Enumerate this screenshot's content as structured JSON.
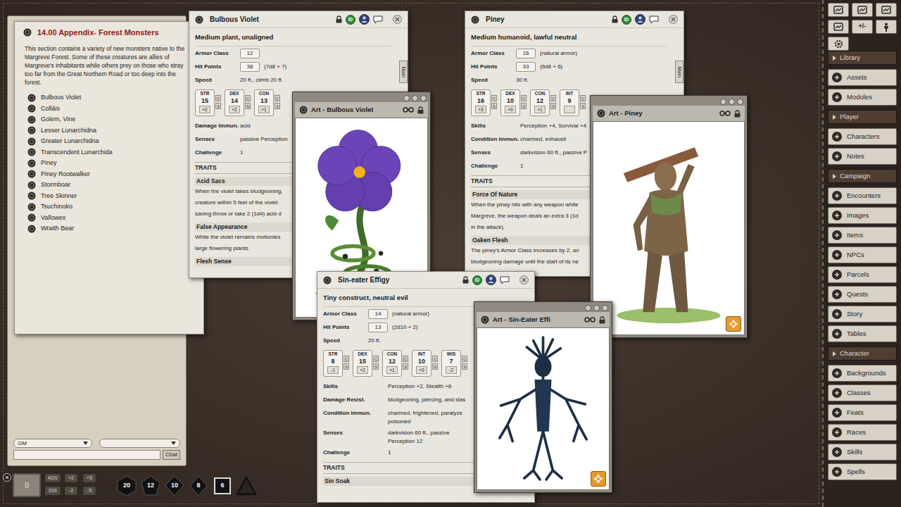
{
  "appendix": {
    "title": "14.00 Appendix- Forest Monsters",
    "intro_lines": [
      "This section contains a variety of new monsters native to the",
      "Margreve Forest. Some of these creatures are allies of",
      "Margreve's inhabitants while others prey on those who stray",
      "too far from the Great Northern Road or too deep into the",
      "forest."
    ],
    "items": [
      "Bulbous Violet",
      "Colláis",
      "Golem, Vine",
      "Lesser Lunarchidna",
      "Greater Lunarchidna",
      "Transcendent Lunarchida",
      "Piney",
      "Piney Rootwalker",
      "Stormboar",
      "Tree Skinner",
      "Tsuchinoko",
      "Vallowex",
      "Wraith Bear"
    ]
  },
  "chat": {
    "identity": "GM",
    "button": "Chat"
  },
  "ability_buttons": [
    "C",
    "S"
  ],
  "statblocks": [
    {
      "name": "Bulbous Violet",
      "id_badge": "ID",
      "tab": "Main",
      "type": "Medium plant, unaligned",
      "armor": {
        "label": "Armor Class",
        "value": "12"
      },
      "hit_points": {
        "label": "Hit Points",
        "value": "38",
        "note": "(7d8 + 7)"
      },
      "speed": {
        "label": "Speed",
        "value": "20 ft., climb 20 ft."
      },
      "abilities": [
        {
          "label": "STR",
          "score": "15",
          "mod": "+2"
        },
        {
          "label": "DEX",
          "score": "14",
          "mod": "+2"
        },
        {
          "label": "CON",
          "score": "13",
          "mod": "+1"
        }
      ],
      "properties": [
        {
          "label": "Damage Immun.",
          "lines": [
            "acid"
          ]
        },
        {
          "label": "Senses",
          "lines": [
            "passive Perception"
          ]
        },
        {
          "label": "Challenge",
          "lines": [
            "1"
          ]
        }
      ],
      "traits_heading": "TRAITS",
      "traits": [
        {
          "name": "Acid Sacs",
          "lines": [
            "When the violet takes bludgeoning,",
            "creature within 5 feet of the violet",
            "saving throw or take 2 (1d4) acid d"
          ]
        },
        {
          "name": "False Appearance",
          "lines": [
            "While the violet remains motionles",
            "large flowering plants."
          ]
        },
        {
          "name": "Flesh Sense",
          "lines": []
        }
      ]
    },
    {
      "name": "Piney",
      "id_badge": "ID",
      "tab": "Main",
      "type": "Medium humanoid, lawful neutral",
      "armor": {
        "label": "Armor Class",
        "value": "16",
        "note": "(natural armor)"
      },
      "hit_points": {
        "label": "Hit Points",
        "value": "33",
        "note": "(6d8 + 6)"
      },
      "speed": {
        "label": "Speed",
        "value": "30 ft."
      },
      "abilities": [
        {
          "label": "STR",
          "score": "16",
          "mod": "+3"
        },
        {
          "label": "DEX",
          "score": "10",
          "mod": "+0"
        },
        {
          "label": "CON",
          "score": "12",
          "mod": "+1"
        },
        {
          "label": "INT",
          "score": "9"
        }
      ],
      "properties": [
        {
          "label": "Skills",
          "lines": [
            "Perception +4, Survival +4"
          ]
        },
        {
          "label": "Condition Immun.",
          "lines": [
            "charmed, exhausti"
          ]
        },
        {
          "label": "Senses",
          "lines": [
            "darkvision 60 ft., passive P"
          ]
        },
        {
          "label": "Challenge",
          "lines": [
            "1"
          ]
        }
      ],
      "traits_heading": "TRAITS",
      "traits": [
        {
          "name": "Force Of Nature",
          "lines": [
            "When the piney hits with any weapon while",
            "Margreve, the weapon deals an extra 3 (1d",
            "in the attack)."
          ]
        },
        {
          "name": "Oaken Flesh",
          "lines": [
            "The piney's Armor Class increases by 2, an",
            "bludgeoning damage until the start of its ne"
          ]
        }
      ]
    },
    {
      "name": "Sin-eater Effigy",
      "id_badge": "ID",
      "type": "Tiny construct, neutral evil",
      "armor": {
        "label": "Armor Class",
        "value": "14",
        "note": "(natural armor)"
      },
      "hit_points": {
        "label": "Hit Points",
        "value": "13",
        "note": "(2d10 + 2)"
      },
      "speed": {
        "label": "Speed",
        "value": "20 ft."
      },
      "abilities": [
        {
          "label": "STR",
          "score": "8",
          "mod": "-1"
        },
        {
          "label": "DEX",
          "score": "15",
          "mod": "+2"
        },
        {
          "label": "CON",
          "score": "12",
          "mod": "+1"
        },
        {
          "label": "INT",
          "score": "10",
          "mod": "+0"
        },
        {
          "label": "WIS",
          "score": "7",
          "mod": "-2"
        }
      ],
      "properties": [
        {
          "label": "Skills",
          "lines": [
            "Perception +2, Stealth +6"
          ]
        },
        {
          "label": "Damage Resist.",
          "lines": [
            "bludgeoning, piercing, and slas"
          ]
        },
        {
          "label": "Condition Immun.",
          "lines": [
            "charmed, frightened, paralyze",
            "poisoned"
          ]
        },
        {
          "label": "Senses",
          "lines": [
            "darkvision 60 ft., passive Perception 12"
          ]
        },
        {
          "label": "Challenge",
          "lines": [
            "1"
          ]
        }
      ],
      "traits_heading": "TRAITS",
      "traits": [
        {
          "name": "Sin Soak",
          "lines": []
        }
      ]
    }
  ],
  "art_windows": [
    {
      "title": "Art - Bulbous Violet",
      "kind": "violet",
      "token": false
    },
    {
      "title": "Art - Piney",
      "kind": "piney",
      "token": true
    },
    {
      "title": "Art - Sin-Eater Effi",
      "kind": "effigy",
      "token": true
    }
  ],
  "sidebar": {
    "tools_label": "+/-",
    "sections": [
      {
        "title": "Library",
        "items": [
          "Assets",
          "Modules"
        ]
      },
      {
        "title": "Player",
        "items": [
          "Characters",
          "Notes"
        ]
      },
      {
        "title": "Campaign",
        "items": [
          "Encounters",
          "Images",
          "Items",
          "NPCs",
          "Parcels",
          "Quests",
          "Story",
          "Tables"
        ]
      },
      {
        "title": "Character",
        "items": [
          "Backgrounds",
          "Classes",
          "Feats",
          "Races",
          "Skills",
          "Spells"
        ]
      }
    ]
  },
  "dice_tray": {
    "modifier": "0",
    "adv": "ADV",
    "dis": "DIS",
    "modifiers": [
      "+2",
      "+5",
      "-2",
      "-5"
    ],
    "dice": [
      {
        "kind": "d20",
        "label": "20"
      },
      {
        "kind": "d12",
        "label": "12"
      },
      {
        "kind": "d10",
        "label": "10"
      },
      {
        "kind": "d8",
        "label": "8"
      },
      {
        "kind": "d6",
        "label": "6"
      },
      {
        "kind": "d4"
      }
    ]
  }
}
